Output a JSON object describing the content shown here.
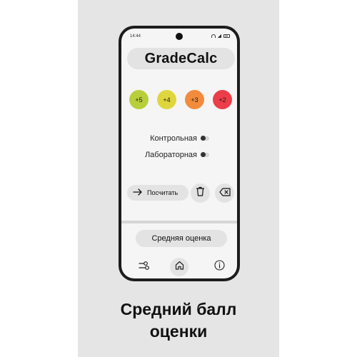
{
  "status_bar": {
    "time": "14:44"
  },
  "app": {
    "title": "GradeCalc"
  },
  "grades": [
    {
      "label": "+5",
      "color": "#b8cf3a"
    },
    {
      "label": "+4",
      "color": "#dfd63e"
    },
    {
      "label": "+3",
      "color": "#f28c3c"
    },
    {
      "label": "+2",
      "color": "#ec3d4a"
    }
  ],
  "toggles": [
    {
      "label": "Контрольная",
      "on": false
    },
    {
      "label": "Лабораторная",
      "on": false
    }
  ],
  "actions": {
    "calculate_label": "Посчитать",
    "calculate_icon": "arrow-right-icon",
    "delete_icon": "trash-icon",
    "backspace_icon": "backspace-icon"
  },
  "result": {
    "average_label": "Средняя оценка"
  },
  "bottom_nav": {
    "items": [
      {
        "icon": "filter-icon"
      },
      {
        "icon": "home-icon",
        "active": true
      },
      {
        "icon": "info-icon"
      }
    ]
  },
  "caption": {
    "line1": "Средний балл",
    "line2": "оценки"
  },
  "colors": {
    "background_panel": "#e5e5e5",
    "phone_frame": "#1c1c1c",
    "pill": "#e3e3e3"
  }
}
